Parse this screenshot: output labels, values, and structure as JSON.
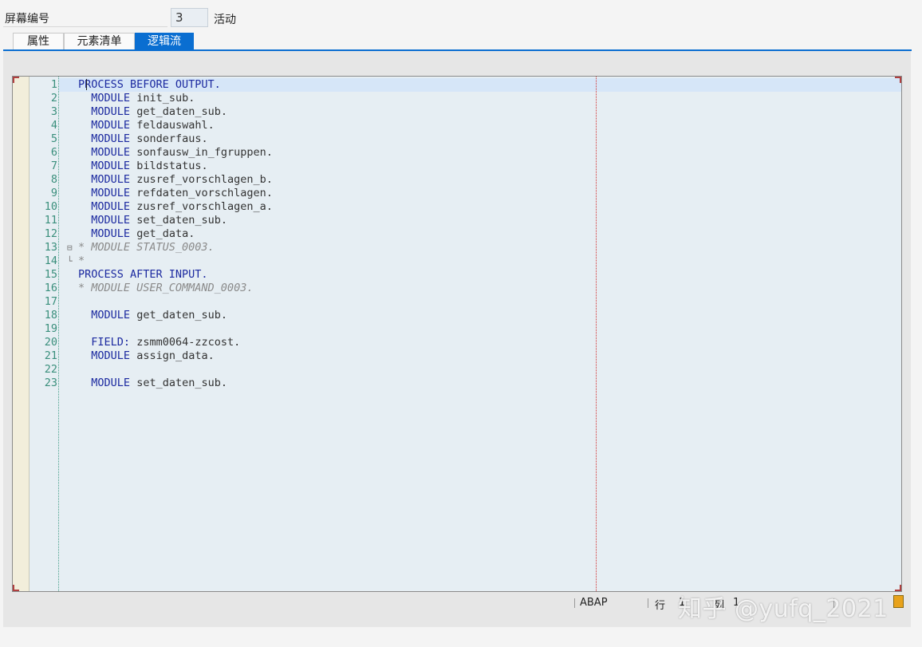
{
  "header": {
    "screen_number_label": "屏幕编号",
    "screen_number_value": "3",
    "status": "活动"
  },
  "tabs": [
    {
      "label": "属性",
      "active": false
    },
    {
      "label": "元素清单",
      "active": false
    },
    {
      "label": "逻辑流",
      "active": true
    }
  ],
  "editor": {
    "lines": [
      {
        "n": "1",
        "kw": "PROCESS BEFORE OUTPUT.",
        "id": "",
        "type": "kw0"
      },
      {
        "n": "2",
        "kw": "MODULE",
        "id": "init_sub.",
        "type": "mod"
      },
      {
        "n": "3",
        "kw": "MODULE",
        "id": "get_daten_sub.",
        "type": "mod"
      },
      {
        "n": "4",
        "kw": "MODULE",
        "id": "feldauswahl.",
        "type": "mod"
      },
      {
        "n": "5",
        "kw": "MODULE",
        "id": "sonderfaus.",
        "type": "mod"
      },
      {
        "n": "6",
        "kw": "MODULE",
        "id": "sonfausw_in_fgruppen.",
        "type": "mod"
      },
      {
        "n": "7",
        "kw": "MODULE",
        "id": "bildstatus.",
        "type": "mod"
      },
      {
        "n": "8",
        "kw": "MODULE",
        "id": "zusref_vorschlagen_b.",
        "type": "mod"
      },
      {
        "n": "9",
        "kw": "MODULE",
        "id": "refdaten_vorschlagen.",
        "type": "mod"
      },
      {
        "n": "10",
        "kw": "MODULE",
        "id": "zusref_vorschlagen_a.",
        "type": "mod"
      },
      {
        "n": "11",
        "kw": "MODULE",
        "id": "set_daten_sub.",
        "type": "mod"
      },
      {
        "n": "12",
        "kw": "MODULE",
        "id": "get_data.",
        "type": "mod"
      },
      {
        "n": "13",
        "kw": "* MODULE STATUS_0003.",
        "id": "",
        "type": "cm",
        "fold": "⊟"
      },
      {
        "n": "14",
        "kw": "*",
        "id": "",
        "type": "cm",
        "fold": "└"
      },
      {
        "n": "15",
        "kw": "PROCESS AFTER INPUT.",
        "id": "",
        "type": "kw0"
      },
      {
        "n": "16",
        "kw": "* MODULE USER_COMMAND_0003.",
        "id": "",
        "type": "cm"
      },
      {
        "n": "17",
        "kw": "",
        "id": "",
        "type": "blank"
      },
      {
        "n": "18",
        "kw": "MODULE",
        "id": "get_daten_sub.",
        "type": "mod"
      },
      {
        "n": "19",
        "kw": "",
        "id": "",
        "type": "blank"
      },
      {
        "n": "20",
        "kw": "FIELD:",
        "id": "zsmm0064-zzcost.",
        "type": "mod"
      },
      {
        "n": "21",
        "kw": "MODULE",
        "id": "assign_data.",
        "type": "mod"
      },
      {
        "n": "22",
        "kw": "",
        "id": "",
        "type": "blank"
      },
      {
        "n": "23",
        "kw": "MODULE",
        "id": "set_daten_sub.",
        "type": "mod"
      }
    ]
  },
  "statusbar": {
    "language": "ABAP",
    "row_label": "行",
    "row_value": "1",
    "col_label": "列",
    "col_value": "1"
  },
  "watermark": "知乎 @yufq_2021"
}
